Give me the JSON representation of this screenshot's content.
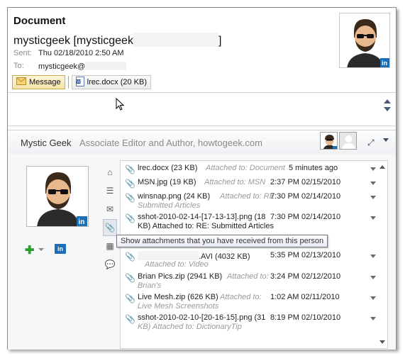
{
  "header": {
    "title": "Document",
    "sender": "mysticgeek [mysticgeek",
    "sender_close": "]",
    "sent_label": "Sent:",
    "sent_value": "Thu 02/18/2010 2:50 AM",
    "to_label": "To:",
    "to_value": "mysticgeek@"
  },
  "attachments_bar": {
    "message_label": "Message",
    "file_label": "lrec.docx (20 KB)"
  },
  "people_pane": {
    "name": "Mystic Geek",
    "title": "Associate Editor and Author, howtogeek.com",
    "linkedin_label": "in",
    "tooltip": "Show attachments that you have received from this person"
  },
  "attachments": [
    {
      "file": "lrec.docx (23 KB)",
      "context": "Attached to: Document",
      "date": "5 minutes ago",
      "context_line2": ""
    },
    {
      "file": "MSN.jpg (19 KB)",
      "context": "Attached to: MSN",
      "date": "2:37 PM 02/15/2010",
      "context_line2": ""
    },
    {
      "file": "winsnap.png (24 KB)",
      "context": "Attached to: RE:",
      "date": "7:30 PM 02/14/2010",
      "context_line2": "Submitted Articles"
    },
    {
      "file": "sshot-2010-02-14-[17-13-13].png (18",
      "context": "",
      "date": "7:30 PM 02/14/2010",
      "context_line2": "KB)   Attached to: RE: Submitted Articles"
    },
    {
      "file": ".AVI (4032 KB)",
      "context": "",
      "date": "5:35 PM 02/13/2010",
      "context_line2": "Attached to: Video"
    },
    {
      "file": "Brian Pics.zip (2941 KB)",
      "context": "Attached to:",
      "date": "3:24 PM 02/12/2010",
      "context_line2": "Brian's"
    },
    {
      "file": "Live Mesh.zip (626 KB)",
      "context": "Attached to:",
      "date": "1:02 AM 02/11/2010",
      "context_line2": "Live Mesh Screenshots"
    },
    {
      "file": "sshot-2010-02-10-[20-16-15].png (31",
      "context": "",
      "date": "8:19 PM 02/10/2010",
      "context_line2": "KB)   Attached to: DictionaryTip"
    }
  ]
}
